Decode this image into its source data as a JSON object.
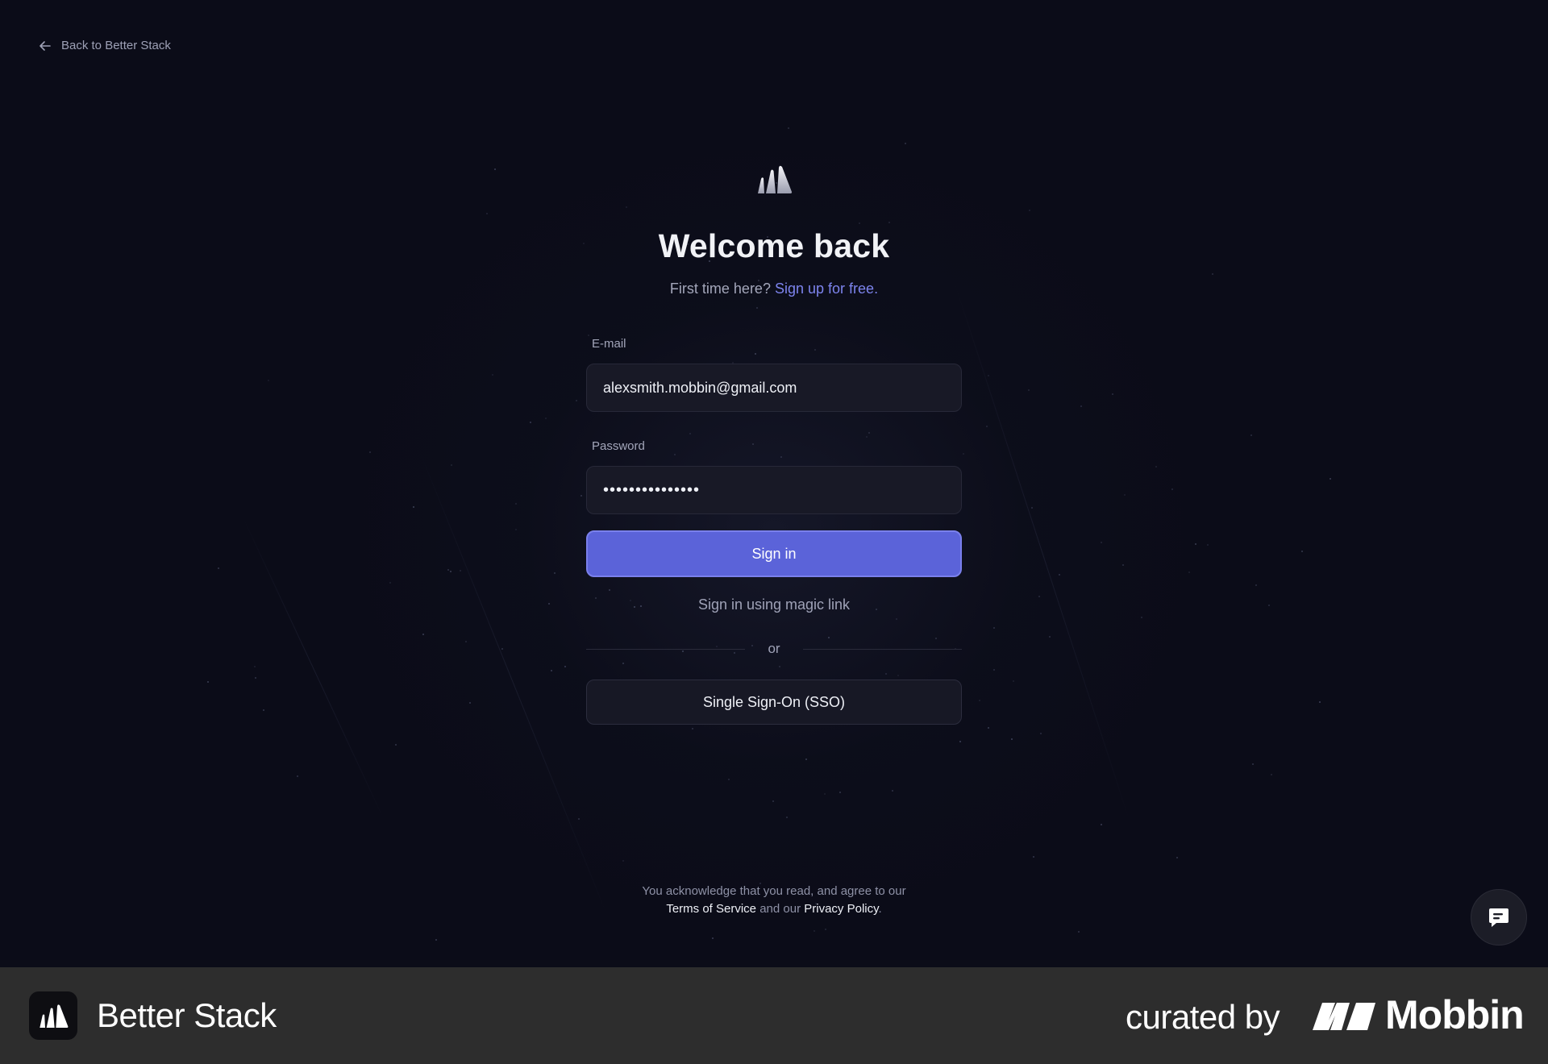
{
  "nav": {
    "back_label": "Back to Better Stack"
  },
  "header": {
    "title": "Welcome back",
    "subtitle_prefix": "First time here?",
    "signup_link": "Sign up for free",
    "subtitle_suffix": "."
  },
  "form": {
    "email_label": "E-mail",
    "email_value": "alexsmith.mobbin@gmail.com",
    "password_label": "Password",
    "password_value": "•••••••••••••••",
    "sign_in_label": "Sign in",
    "magic_link_label": "Sign in using magic link",
    "divider_label": "or",
    "sso_label": "Single Sign-On (SSO)"
  },
  "legal": {
    "line1": "You acknowledge that you read, and agree to our",
    "terms_link": "Terms of Service",
    "and_our": "and our",
    "privacy_link": "Privacy Policy",
    "period": "."
  },
  "chat": {
    "icon": "chat-bubble-icon"
  },
  "footer": {
    "app_name": "Better Stack",
    "curated_by": "curated by",
    "brand": "Mobbin"
  },
  "colors": {
    "background": "#0b0c18",
    "accent": "#5b63d9",
    "link": "#7d84ee",
    "footer_bg": "#2d2d2d"
  }
}
